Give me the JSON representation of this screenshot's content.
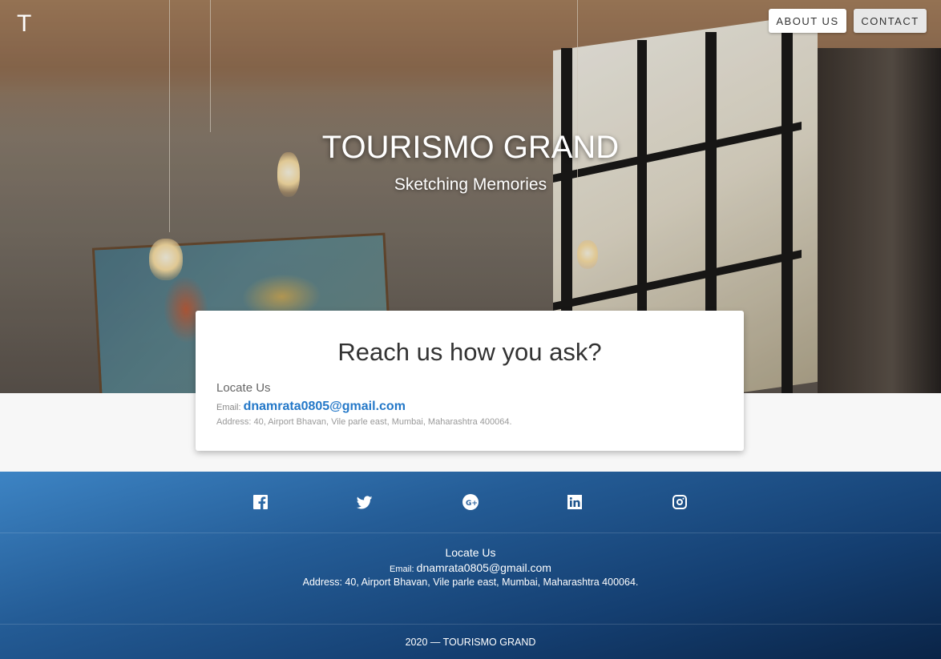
{
  "brand": {
    "logo_letter": "T"
  },
  "nav": {
    "about_label": "ABOUT US",
    "contact_label": "CONTACT"
  },
  "hero": {
    "title": "TOURISMO GRAND",
    "subtitle": "Sketching Memories"
  },
  "card": {
    "title": "Reach us how you ask?",
    "locate_heading": "Locate Us",
    "email_prefix": "Email:",
    "email_value": "dnamrata0805@gmail.com",
    "address": "Address: 40, Airport Bhavan, Vile parle east, Mumbai, Maharashtra 400064."
  },
  "footer": {
    "social": [
      "facebook-icon",
      "twitter-icon",
      "google-plus-icon",
      "linkedin-icon",
      "instagram-icon"
    ],
    "locate_heading": "Locate Us",
    "email_prefix": "Email:",
    "email_value": "dnamrata0805@gmail.com",
    "address": "Address: 40, Airport Bhavan, Vile parle east, Mumbai, Maharashtra 400064.",
    "copyright_year": "2020 —",
    "copyright_name": "TOURISMO GRAND"
  },
  "colors": {
    "link": "#2478c8",
    "footer_top": "#3d84c4",
    "footer_bottom": "#0a2447"
  }
}
